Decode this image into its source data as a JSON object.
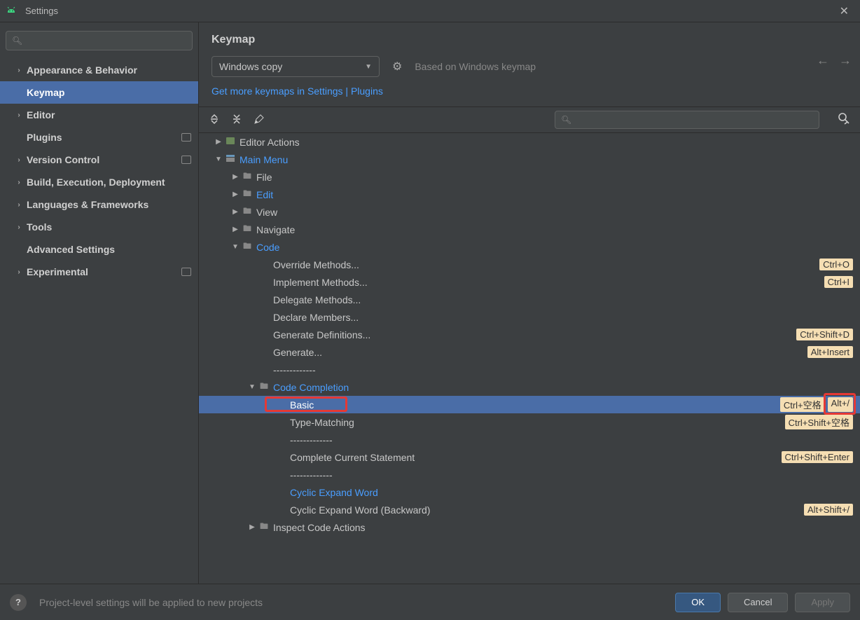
{
  "window": {
    "title": "Settings"
  },
  "sidebar": {
    "items": [
      {
        "label": "Appearance & Behavior",
        "chev": true,
        "badge": false
      },
      {
        "label": "Keymap",
        "chev": false,
        "badge": false,
        "selected": true,
        "indent": true
      },
      {
        "label": "Editor",
        "chev": true,
        "badge": false
      },
      {
        "label": "Plugins",
        "chev": false,
        "badge": true,
        "indent": true
      },
      {
        "label": "Version Control",
        "chev": true,
        "badge": true
      },
      {
        "label": "Build, Execution, Deployment",
        "chev": true,
        "badge": false
      },
      {
        "label": "Languages & Frameworks",
        "chev": true,
        "badge": false
      },
      {
        "label": "Tools",
        "chev": true,
        "badge": false
      },
      {
        "label": "Advanced Settings",
        "chev": false,
        "badge": false,
        "indent": true
      },
      {
        "label": "Experimental",
        "chev": true,
        "badge": true
      }
    ]
  },
  "main": {
    "title": "Keymap",
    "keymap_selected": "Windows copy",
    "based_on": "Based on Windows keymap",
    "link": "Get more keymaps in Settings | Plugins"
  },
  "tree": [
    {
      "depth": 0,
      "arrow": "▶",
      "icon": "actions",
      "label": "Editor Actions"
    },
    {
      "depth": 0,
      "arrow": "▼",
      "icon": "menu",
      "label": "Main Menu",
      "link": true
    },
    {
      "depth": 1,
      "arrow": "▶",
      "icon": "folder",
      "label": "File"
    },
    {
      "depth": 1,
      "arrow": "▶",
      "icon": "folder",
      "label": "Edit",
      "link": true
    },
    {
      "depth": 1,
      "arrow": "▶",
      "icon": "folder",
      "label": "View"
    },
    {
      "depth": 1,
      "arrow": "▶",
      "icon": "folder",
      "label": "Navigate"
    },
    {
      "depth": 1,
      "arrow": "▼",
      "icon": "folder",
      "label": "Code",
      "link": true
    },
    {
      "depth": 2,
      "label": "Override Methods...",
      "shortcuts": [
        "Ctrl+O"
      ]
    },
    {
      "depth": 2,
      "label": "Implement Methods...",
      "shortcuts": [
        "Ctrl+I"
      ]
    },
    {
      "depth": 2,
      "label": "Delegate Methods..."
    },
    {
      "depth": 2,
      "label": "Declare Members..."
    },
    {
      "depth": 2,
      "label": "Generate Definitions...",
      "shortcuts": [
        "Ctrl+Shift+D"
      ]
    },
    {
      "depth": 2,
      "label": "Generate...",
      "shortcuts": [
        "Alt+Insert"
      ]
    },
    {
      "depth": 2,
      "label": "-------------"
    },
    {
      "depth": 2,
      "arrow": "▼",
      "icon": "folder",
      "label": "Code Completion",
      "link": true
    },
    {
      "depth": 3,
      "label": "Basic",
      "shortcuts": [
        "Ctrl+空格",
        "Alt+/"
      ],
      "selected": true,
      "highlight_label": true,
      "highlight_sc": 1
    },
    {
      "depth": 3,
      "label": "Type-Matching",
      "shortcuts": [
        "Ctrl+Shift+空格"
      ]
    },
    {
      "depth": 3,
      "label": "-------------"
    },
    {
      "depth": 3,
      "label": "Complete Current Statement",
      "shortcuts": [
        "Ctrl+Shift+Enter"
      ]
    },
    {
      "depth": 3,
      "label": "-------------"
    },
    {
      "depth": 3,
      "label": "Cyclic Expand Word",
      "link": true
    },
    {
      "depth": 3,
      "label": "Cyclic Expand Word (Backward)",
      "shortcuts": [
        "Alt+Shift+/"
      ]
    },
    {
      "depth": 2,
      "arrow": "▶",
      "icon": "folder",
      "label": "Inspect Code Actions"
    }
  ],
  "footer": {
    "text": "Project-level settings will be applied to new projects",
    "ok": "OK",
    "cancel": "Cancel",
    "apply": "Apply"
  }
}
